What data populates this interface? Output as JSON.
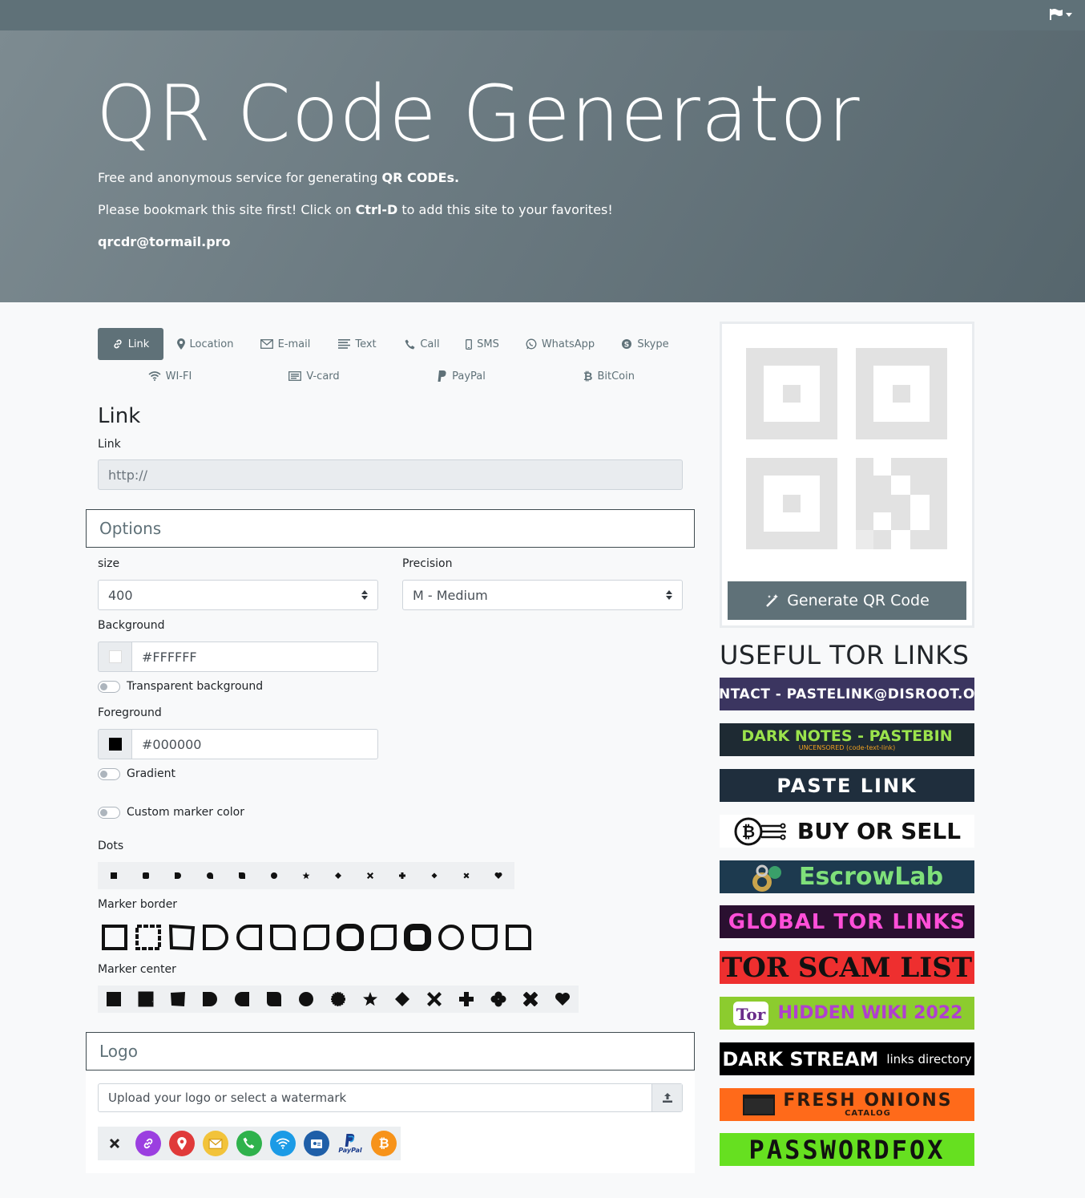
{
  "header": {
    "flag_menu": "language menu"
  },
  "hero": {
    "title": "QR Code Generator",
    "line1_pre": "Free and anonymous service for generating ",
    "line1_bold": "QR CODEs.",
    "line2_pre": "Please bookmark this site first! Click on ",
    "line2_bold": "Ctrl-D",
    "line2_post": " to add this site to your favorites!",
    "email": "qrcdr@tormail.pro"
  },
  "tabs": [
    {
      "label": "Link",
      "icon": "link-icon",
      "active": true
    },
    {
      "label": "Location",
      "icon": "map-pin-icon"
    },
    {
      "label": "E-mail",
      "icon": "envelope-icon"
    },
    {
      "label": "Text",
      "icon": "text-lines-icon"
    },
    {
      "label": "Call",
      "icon": "phone-icon"
    },
    {
      "label": "SMS",
      "icon": "mobile-icon"
    },
    {
      "label": "WhatsApp",
      "icon": "whatsapp-icon"
    },
    {
      "label": "Skype",
      "icon": "skype-icon"
    },
    {
      "label": "WI-FI",
      "icon": "wifi-icon"
    },
    {
      "label": "V-card",
      "icon": "vcard-icon"
    },
    {
      "label": "PayPal",
      "icon": "paypal-icon"
    },
    {
      "label": "BitCoin",
      "icon": "bitcoin-icon"
    }
  ],
  "link_section": {
    "title": "Link",
    "field_label": "Link",
    "placeholder": "http://"
  },
  "options": {
    "title": "Options",
    "size_label": "size",
    "size_value": "400",
    "precision_label": "Precision",
    "precision_value": "M - Medium",
    "background_label": "Background",
    "background_value": "#FFFFFF",
    "transparent_label": "Transparent background",
    "foreground_label": "Foreground",
    "foreground_value": "#000000",
    "gradient_label": "Gradient",
    "custom_marker_label": "Custom marker color",
    "dots_label": "Dots",
    "marker_border_label": "Marker border",
    "marker_center_label": "Marker center"
  },
  "logo": {
    "title": "Logo",
    "upload_placeholder": "Upload your logo or select a watermark",
    "watermarks": [
      "none",
      "link",
      "location",
      "email",
      "whatsapp",
      "wifi",
      "vcard",
      "paypal",
      "bitcoin"
    ],
    "paypal_text": "PayPal",
    "bitcoin_symbol": "₿"
  },
  "generate": {
    "label": "Generate QR Code"
  },
  "useful": {
    "title": "USEFUL TOR LINKS",
    "banners": [
      {
        "text": "CONTACT - PASTELINK@DISROOT.ORG",
        "bg": "#3b3560",
        "fg": "#ffffff"
      },
      {
        "text": "DARK NOTES - PASTEBIN",
        "sub": "UNCENSORED (code-text-link)",
        "bg": "#1e2a33",
        "fg": "#9be34c",
        "subfg": "#f0a020"
      },
      {
        "text": "PASTE LINK",
        "bg": "#1f2e3d",
        "fg": "#ffffff"
      },
      {
        "text": "BUY OR SELL",
        "bg": "#ffffff",
        "fg": "#111111"
      },
      {
        "text": "EscrowLab",
        "bg": "#1d3a4f",
        "fg": "#7fe07a"
      },
      {
        "text": "GLOBAL TOR LINKS",
        "bg": "#2a1030",
        "fg": "#ff4fd8"
      },
      {
        "text": "TOR SCAM LIST",
        "bg": "#ee2f2f",
        "fg": "#111111"
      },
      {
        "text": "HIDDEN WIKI 2022",
        "bg": "#8ccc2e",
        "fg": "#b03fcf"
      },
      {
        "text": "DARK STREAM",
        "sub": "links directory",
        "bg": "#000000",
        "fg": "#ffffff"
      },
      {
        "text": "FRESH ONIONS",
        "sub": "CATALOG",
        "bg": "#ff6a1a",
        "fg": "#2a1a10"
      },
      {
        "text": "PASSWORDFOX",
        "bg": "#66e020",
        "fg": "#111111"
      }
    ]
  }
}
